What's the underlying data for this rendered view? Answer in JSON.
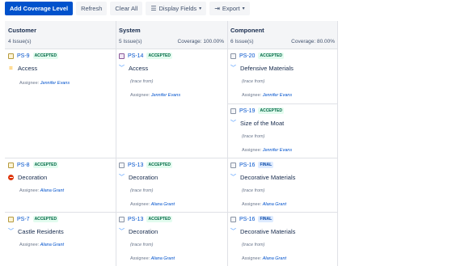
{
  "toolbar": {
    "add_label": "Add Coverage Level",
    "refresh_label": "Refresh",
    "clear_label": "Clear All",
    "display_fields_label": "Display Fields",
    "export_label": "Export"
  },
  "columns": {
    "customer": {
      "title": "Customer",
      "count": "4 Issue(s)",
      "coverage": ""
    },
    "system": {
      "title": "System",
      "count": "5 Issue(s)",
      "coverage": "Coverage: 100.00%"
    },
    "component": {
      "title": "Component",
      "count": "6 Issue(s)",
      "coverage": "Coverage: 80.00%"
    }
  },
  "assignee_prefix": "Assignee:",
  "trace_text": "(trace from)",
  "cards": {
    "c1": {
      "key": "PS-9",
      "status": "ACCEPTED",
      "summary": "Access",
      "assignee": "Jennifer Evans"
    },
    "s1": {
      "key": "PS-14",
      "status": "ACCEPTED",
      "summary": "Access",
      "assignee": "Jennifer Evans"
    },
    "p1": {
      "key": "PS-20",
      "status": "ACCEPTED",
      "summary": "Defensive Materials",
      "assignee": "Jennifer Evans"
    },
    "p2": {
      "key": "PS-19",
      "status": "ACCEPTED",
      "summary": "Size of the Moat",
      "assignee": "Jennifer Evans"
    },
    "c2": {
      "key": "PS-8",
      "status": "ACCEPTED",
      "summary": "Decoration",
      "assignee": "Alana Grant"
    },
    "s2": {
      "key": "PS-13",
      "status": "ACCEPTED",
      "summary": "Decoration",
      "assignee": "Alana Grant"
    },
    "p3": {
      "key": "PS-16",
      "status": "FINAL",
      "summary": "Decorative Materials",
      "assignee": "Alana Grant"
    },
    "c3": {
      "key": "PS-7",
      "status": "ACCEPTED",
      "summary": "Castle Residents",
      "assignee": "Alana Grant"
    },
    "s3": {
      "key": "PS-13",
      "status": "ACCEPTED",
      "summary": "Decoration",
      "assignee": "Alana Grant"
    },
    "p4": {
      "key": "PS-16",
      "status": "FINAL",
      "summary": "Decorative Materials",
      "assignee": "Alana Grant"
    }
  },
  "colors": {
    "primary": "#0052cc",
    "accepted_bg": "#e3fcef",
    "final_bg": "#deebff",
    "header_bg": "#f4f5f7"
  }
}
